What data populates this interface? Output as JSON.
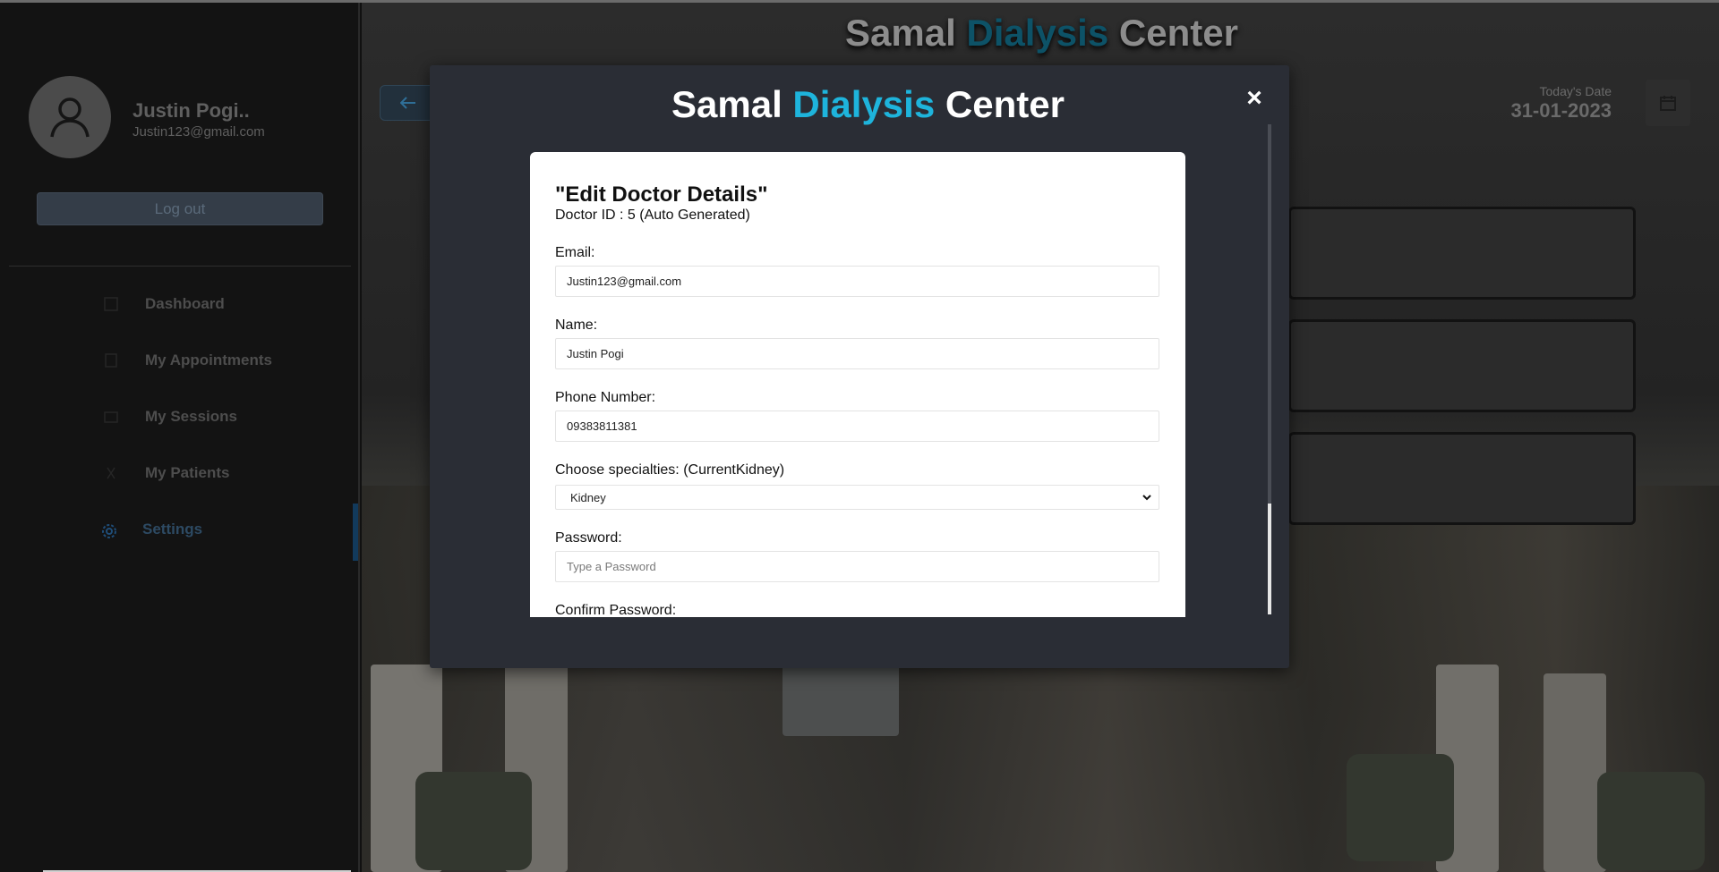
{
  "app": {
    "title_part1": "Samal",
    "title_accent": "Dialysis",
    "title_part2": "Center"
  },
  "sidebar": {
    "profile_name": "Justin Pogi..",
    "profile_email": "Justin123@gmail.com",
    "logout_label": "Log out",
    "items": [
      {
        "label": "Dashboard",
        "icon": "dashboard-icon"
      },
      {
        "label": "My Appointments",
        "icon": "bookmark-icon"
      },
      {
        "label": "My Sessions",
        "icon": "sessions-icon"
      },
      {
        "label": "My Patients",
        "icon": "patients-icon"
      },
      {
        "label": "Settings",
        "icon": "gear-icon",
        "active": true
      }
    ]
  },
  "header": {
    "date_label": "Today's Date",
    "date_value": "31-01-2023"
  },
  "modal": {
    "title_part1": "Samal",
    "title_accent": "Dialysis",
    "title_part2": "Center",
    "close_label": "×",
    "form": {
      "heading": "\"Edit Doctor Details\"",
      "subheading": "Doctor ID : 5 (Auto Generated)",
      "email_label": "Email:",
      "email_value": "Justin123@gmail.com",
      "name_label": "Name:",
      "name_value": "Justin Pogi",
      "phone_label": "Phone Number:",
      "phone_value": "09383811381",
      "specialty_label": "Choose specialties: (CurrentKidney)",
      "specialty_value": "Kidney",
      "password_label": "Password:",
      "password_placeholder": "Type a Password",
      "confirm_label": "Confirm Password:"
    }
  },
  "colors": {
    "accent": "#1eb4dc",
    "modal_bg": "#2a2d35",
    "sidebar_bg": "#131313"
  }
}
